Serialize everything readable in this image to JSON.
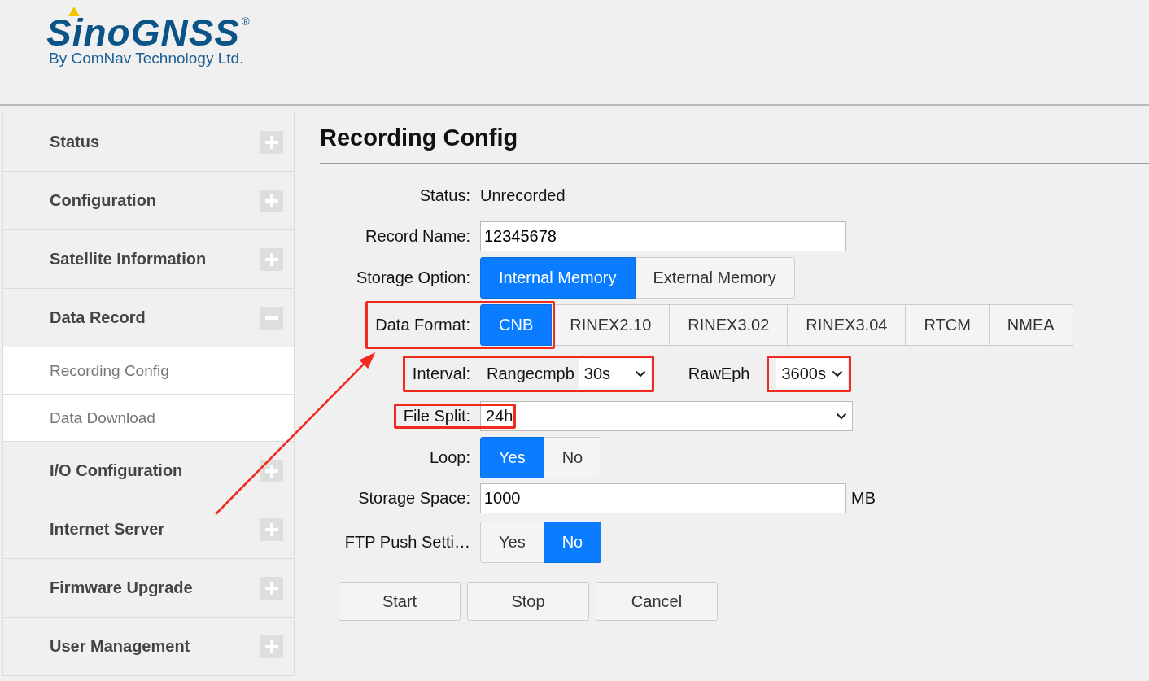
{
  "logo": {
    "brand": "SinoGNSS",
    "registered": "®",
    "tagline": "By ComNav Technology Ltd."
  },
  "sidebar": {
    "items": [
      {
        "label": "Status",
        "expanded": false
      },
      {
        "label": "Configuration",
        "expanded": false
      },
      {
        "label": "Satellite Information",
        "expanded": false
      },
      {
        "label": "Data Record",
        "expanded": true,
        "children": [
          {
            "label": "Recording Config"
          },
          {
            "label": "Data Download"
          }
        ]
      },
      {
        "label": "I/O Configuration",
        "expanded": false
      },
      {
        "label": "Internet Server",
        "expanded": false
      },
      {
        "label": "Firmware Upgrade",
        "expanded": false
      },
      {
        "label": "User Management",
        "expanded": false
      }
    ]
  },
  "page": {
    "title": "Recording Config"
  },
  "form": {
    "rows": [
      {
        "kind": "text",
        "label": "Status:",
        "value": "Unrecorded"
      },
      {
        "kind": "input",
        "label": "Record Name:",
        "value": "12345678"
      },
      {
        "kind": "toggle",
        "label": "Storage Option:",
        "options": [
          {
            "label": "Internal Memory",
            "selected": true
          },
          {
            "label": "External Memory",
            "selected": false
          }
        ]
      },
      {
        "kind": "toggle",
        "label": "Data Format:",
        "framed": true,
        "options": [
          {
            "label": "CNB",
            "selected": true,
            "framed": true
          },
          {
            "label": "RINEX2.10",
            "selected": false
          },
          {
            "label": "RINEX3.02",
            "selected": false
          },
          {
            "label": "RINEX3.04",
            "selected": false
          },
          {
            "label": "RTCM",
            "selected": false
          },
          {
            "label": "NMEA",
            "selected": false
          }
        ]
      },
      {
        "kind": "interval",
        "label": "Interval:",
        "framed": true,
        "parts": [
          {
            "kind": "tag",
            "text": "Rangecmpb",
            "framed": true
          },
          {
            "kind": "select",
            "value": "30s",
            "framed": true
          },
          {
            "kind": "label",
            "text": "RawEph"
          },
          {
            "kind": "select",
            "value": "3600s",
            "framed": true
          }
        ]
      },
      {
        "kind": "select",
        "label": "File Split:",
        "framed": true,
        "value": "24h",
        "value_framed": true
      },
      {
        "kind": "toggle",
        "label": "Loop:",
        "options": [
          {
            "label": "Yes",
            "selected": true
          },
          {
            "label": "No",
            "selected": false
          }
        ]
      },
      {
        "kind": "input",
        "label": "Storage Space:",
        "value": "1000",
        "unit": "MB"
      },
      {
        "kind": "toggle",
        "label": "FTP Push Setti…",
        "options": [
          {
            "label": "Yes",
            "selected": false
          },
          {
            "label": "No",
            "selected": true
          }
        ]
      }
    ]
  },
  "buttons": [
    "Start",
    "Stop",
    "Cancel"
  ],
  "annotation_arrow": true
}
